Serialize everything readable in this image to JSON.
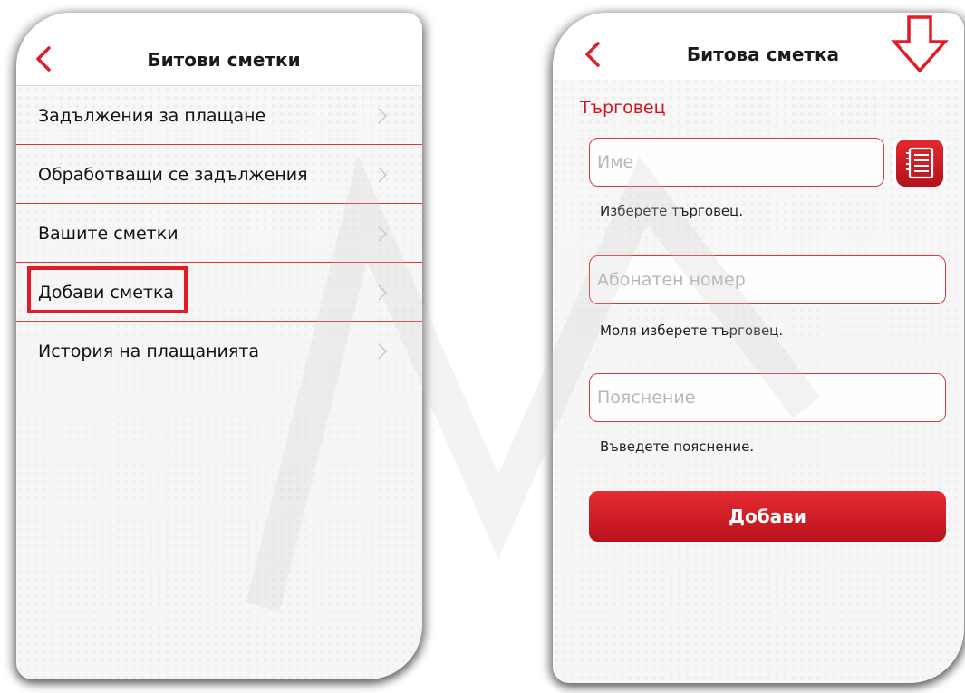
{
  "left_screen": {
    "title": "Битови сметки",
    "menu_items": [
      {
        "label": "Задължения за плащане"
      },
      {
        "label": "Обработващи се задължения"
      },
      {
        "label": "Вашите сметки"
      },
      {
        "label": "Добави сметка"
      },
      {
        "label": "История на плащанията"
      }
    ],
    "highlighted_item": "Добави сметка"
  },
  "right_screen": {
    "title": "Битова сметка",
    "section_title": "Търговец",
    "merchant_field": {
      "placeholder": "Име",
      "value": ""
    },
    "merchant_hint": "Изберете търговец.",
    "subscriber_field": {
      "placeholder": "Абонатен номер",
      "value": ""
    },
    "subscriber_hint": "Моля изберете търговец.",
    "note_field": {
      "placeholder": "Пояснение",
      "value": ""
    },
    "note_hint": "Въведете пояснение.",
    "submit_label": "Добави",
    "catalog_icon": "list-icon"
  },
  "colors": {
    "accent": "#e31b25",
    "highlight_border": "#e31b25",
    "button_gradient_top": "#e62b33",
    "button_gradient_bottom": "#b9121b"
  }
}
